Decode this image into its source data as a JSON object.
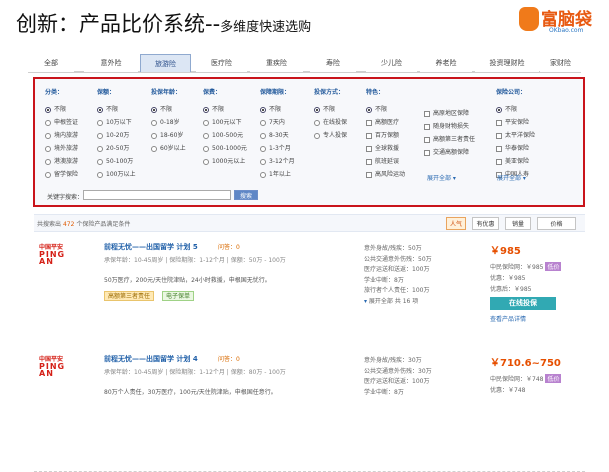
{
  "header": {
    "title": "创新：产品比价系统--",
    "subtitle": "多维度快速选购",
    "logo_text": "富脑袋",
    "logo_domain": "OKbao.com"
  },
  "tabs": [
    "全部",
    "意外险",
    "旅游险",
    "医疗险",
    "重疾险",
    "寿险",
    "少儿险",
    "养老险",
    "投资理财险",
    "家财险"
  ],
  "filters": [
    {
      "label": "分类：",
      "options": [
        "不限",
        "申根签证",
        "境内旅游",
        "境外旅游",
        "港澳旅游",
        "留学保险"
      ]
    },
    {
      "label": "保额：",
      "options": [
        "不限",
        "10万以下",
        "10-20万",
        "20-50万",
        "50-100万",
        "100万以上"
      ]
    },
    {
      "label": "投保年龄：",
      "options": [
        "不限",
        "0-18岁",
        "18-60岁",
        "60岁以上"
      ]
    },
    {
      "label": "保费：",
      "options": [
        "不限",
        "100元以下",
        "100-500元",
        "500-1000元",
        "1000元以上"
      ]
    },
    {
      "label": "保障期限：",
      "options": [
        "不限",
        "7天内",
        "8-30天",
        "1-3个月",
        "3-12个月",
        "1年以上"
      ]
    },
    {
      "label": "投保方式：",
      "options": [
        "不限",
        "在线投保",
        "专人投保"
      ]
    }
  ],
  "features": {
    "label": "特色：",
    "options": [
      "不限",
      "高额医疗",
      "高原地区保障",
      "百万保额",
      "随身财物损失",
      "全球救援",
      "高额第三者责任",
      "航班延误",
      "交通高额保障",
      "高风险运动"
    ],
    "more": "展开全部"
  },
  "companies": {
    "label": "保险公司：",
    "options": [
      "不限",
      "平安保险",
      "太平洋保险",
      "华泰保险",
      "美亚保险",
      "中国人寿"
    ],
    "more": "展开全部"
  },
  "search": {
    "label": "关键字搜索：",
    "button": "搜索"
  },
  "results": {
    "prefix": "共搜索出",
    "count": "472",
    "suffix": "个保险产品满足条件"
  },
  "sorts": [
    "人气",
    "有优惠",
    "销量",
    "价格"
  ],
  "products": [
    {
      "insurer_cn": "中国平安",
      "insurer_en": "PING AN",
      "name": "前程无忧——出国留学 计划 5",
      "ask": "问答：0",
      "info": "承保年龄：10-45周岁 | 保险期限：1-12个月 | 保额：50万 - 100万",
      "desc": "50万医疗，200元/天住院津贴，24小时救援，申根国无忧行。",
      "tags": [
        "高额第三者责任",
        "电子保单"
      ],
      "coverage": [
        [
          "意外身故/残疾：",
          "50万"
        ],
        [
          "公共交通意外伤残：",
          "50万"
        ],
        [
          "医疗运送和送返：",
          "100万"
        ],
        [
          "学业中断：",
          "8万"
        ],
        [
          "旅行者个人责任：",
          "100万"
        ],
        [
          "展开全部 共 16 项",
          ""
        ]
      ],
      "price": "￥985",
      "orig": "中民保险网：￥985",
      "badge": "低价",
      "discount": "优惠：￥985",
      "after": "优惠后：￥985",
      "buy": "在线投保",
      "detail": "查看产品详情"
    },
    {
      "insurer_cn": "中国平安",
      "insurer_en": "PING AN",
      "name": "前程无忧——出国留学 计划 4",
      "ask": "问答：0",
      "info": "承保年龄：10-45周岁 | 保险期限：1-12个月 | 保额：80万 - 100万",
      "desc": "80万个人责任，30万医疗，100元/天住院津贴，申根国任意行。",
      "tags": [],
      "coverage": [
        [
          "意外身故/残疾：",
          "30万"
        ],
        [
          "公共交通意外伤残：",
          "30万"
        ],
        [
          "医疗运送和送返：",
          "100万"
        ],
        [
          "学业中断：",
          "8万"
        ],
        [
          "",
          ""
        ],
        [
          "",
          ""
        ]
      ],
      "price": "￥710.6~750",
      "orig": "中民保险网：￥748",
      "badge": "低价",
      "discount": "优惠：￥748",
      "after": "",
      "buy": "",
      "detail": ""
    }
  ]
}
